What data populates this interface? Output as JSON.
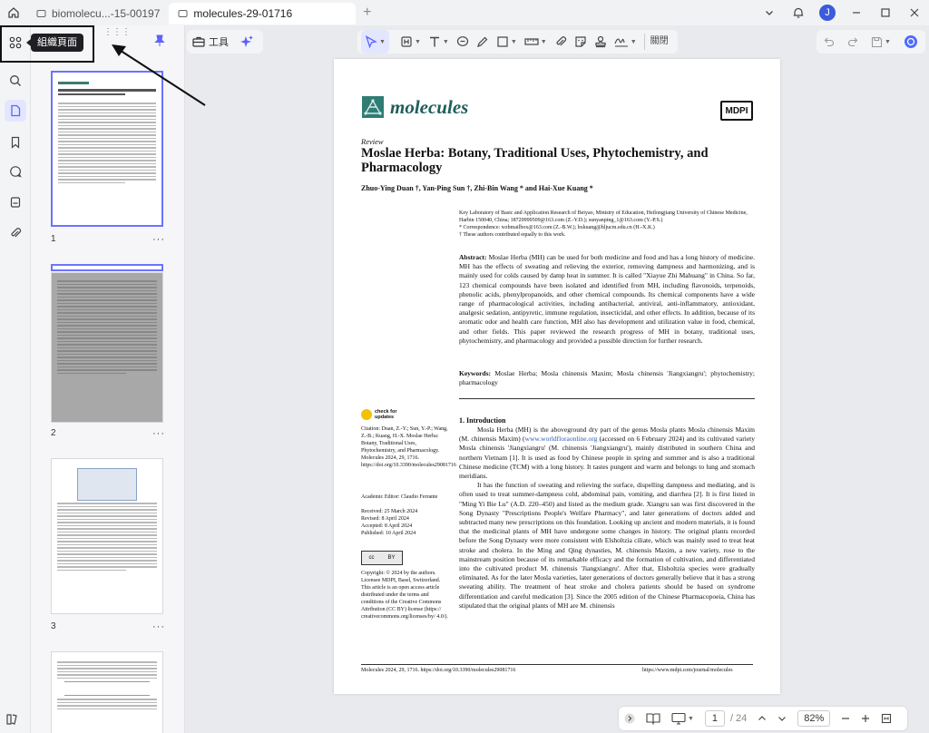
{
  "tabs": [
    {
      "label": "biomolecu...-15-00197",
      "active": false
    },
    {
      "label": "molecules-29-01716",
      "active": true
    }
  ],
  "user": {
    "avatar_initial": "J"
  },
  "tooltip": {
    "text": "組織頁面"
  },
  "toolbar": {
    "tools_label": "工具",
    "close_label": "關閉"
  },
  "thumbnails": [
    {
      "label": "1"
    },
    {
      "label": "2"
    },
    {
      "label": "3"
    }
  ],
  "thumb_more": "···",
  "page": {
    "journal": "molecules",
    "publisher": "MDPI",
    "type": "Review",
    "title": "Moslae Herba: Botany, Traditional Uses, Phytochemistry, and Pharmacology",
    "authors": "Zhuo-Ying Duan †, Yan-Ping Sun †, Zhi-Bin Wang * and Hai-Xue Kuang *",
    "affiliation": "Key Laboratory of Basic and Application Research of Beiyao, Ministry of Education, Heilongjiang University of Chinese Medicine, Harbin 150040, China; 18729999509@163.com (Z.-Y.D.); sunyanping_1@163.com (Y.-P.S.)",
    "correspondence": "*  Correspondence: wzbmailbox@163.com (Z.-B.W.); hxkuang@hljucm.edu.cn (H.-X.K.)",
    "equal": "†  These authors contributed equally to this work.",
    "abstract_label": "Abstract:",
    "abstract": "Moslae Herba (MH) can be used for both medicine and food and has a long history of medicine. MH has the effects of sweating and relieving the exterior, removing dampness and harmonizing, and is mainly used for colds caused by damp heat in summer. It is called \"Xiayue Zhi Mahuang\" in China. So far, 123 chemical compounds have been isolated and identified from MH, including flavonoids, terpenoids, phenolic acids, phenylpropanoids, and other chemical compounds. Its chemical components have a wide range of pharmacological activities, including antibacterial, antiviral, anti-inflammatory, antioxidant, analgesic sedation, antipyretic, immune regulation, insecticidal, and other effects. In addition, because of its aromatic odor and health care function, MH also has development and utilization value in food, chemical, and other fields. This paper reviewed the research progress of MH in botany, traditional uses, phytochemistry, and pharmacology and provided a possible direction for further research.",
    "keywords_label": "Keywords:",
    "keywords": "Moslae Herba; Mosla chinensis Maxim; Mosla chinensis 'Jiangxiangru'; phytochemistry; pharmacology",
    "check_updates_1": "check for",
    "check_updates_2": "updates",
    "citation": "Citation: Duan, Z.-Y.; Sun, Y.-P.; Wang, Z.-B.; Kuang, H.-X. Moslae Herba: Botany, Traditional Uses, Phytochemistry, and Pharmacology. Molecules 2024, 29, 1716. https://doi.org/10.3390/molecules29081716",
    "editor": "Academic Editor: Claudio Ferrante",
    "received": "Received: 25 March 2024",
    "revised": "Revised: 8 April 2024",
    "accepted": "Accepted: 8 April 2024",
    "published": "Published: 10 April 2024",
    "cc_text_1": "cc",
    "cc_text_2": "BY",
    "copyright": "Copyright: © 2024 by the authors. Licensee MDPI, Basel, Switzerland. This article is an open access article distributed under the terms and conditions of the Creative Commons Attribution (CC BY) license (https:// creativecommons.org/licenses/by/ 4.0/).",
    "intro_heading": "1. Introduction",
    "intro_p1_a": "Mosla Herba (MH) is the aboveground dry part of the genus Mosla plants Mosla chinensis Maxim (M. chinensis Maxim) (",
    "intro_link": "www.worldfloraonline.org",
    "intro_p1_b": " (accessed on 6 February 2024) and its cultivated variety Mosla chinensis 'Jiangxiangru' (M. chinensis 'Jiangxiangru'), mainly distributed in southern China and northern Vietnam [1]. It is used as food by Chinese people in spring and summer and is also a traditional Chinese medicine (TCM) with a long history. It tastes pungent and warm and belongs to lung and stomach meridians.",
    "intro_p2": "It has the function of sweating and relieving the surface, dispelling dampness and mediating, and is often used to treat summer-dampness cold, abdominal pain, vomiting, and diarrhea [2]. It is first listed in \"Ming Yi Bie Lu\" (A.D. 220–450) and listed as the medium grade. Xiangru san was first discovered in the Song Dynasty \"Prescriptions People's Welfare Pharmacy\", and later generations of doctors added and subtracted many new prescriptions on this foundation. Looking up ancient and modern materials, it is found that the medicinal plants of MH have undergone some changes in history. The original plants recorded before the Song Dynasty were more consistent with Elsholtzia ciliate, which was mainly used to treat heat stroke and cholera. In the Ming and Qing dynasties, M. chinensis Maxim, a new variety, rose to the mainstream position because of its remarkable efficacy and the formation of cultivation, and differentiated into the cultivated product M. chinensis 'Jiangxiangru'. After that, Elsholtzia species were gradually eliminated. As for the later Mosla varieties, later generations of doctors generally believe that it has a strong sweating ability. The treatment of heat stroke and cholera patients should be based on syndrome differentiation and careful medication [3]. Since the 2005 edition of the Chinese Pharmacopoeia, China has stipulated that the original plants of MH are M. chinensis",
    "footer_left": "Molecules 2024, 29, 1716. https://doi.org/10.3390/molecules29081716",
    "footer_right": "https://www.mdpi.com/journal/molecules"
  },
  "bottom": {
    "current_page": "1",
    "total_pages": "/ 24",
    "zoom": "82%"
  },
  "colors": {
    "accent": "#6b73ff",
    "journal": "#1e5f5a"
  }
}
